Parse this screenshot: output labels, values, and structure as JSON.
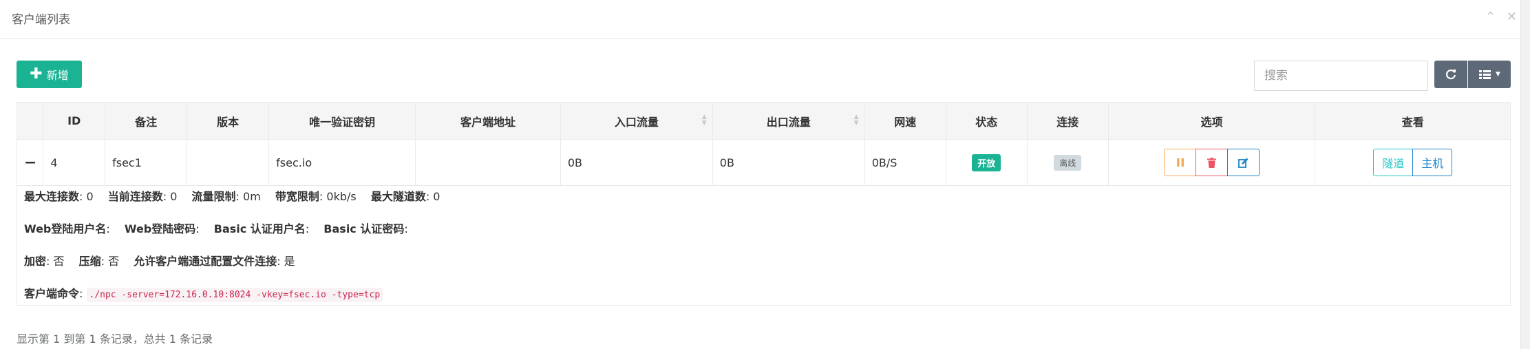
{
  "panel": {
    "title": "客户端列表",
    "collapse_icon": "chevron-up-icon",
    "close_icon": "close-icon"
  },
  "toolbar": {
    "add_label": "新增",
    "search_placeholder": "搜索",
    "refresh_icon": "refresh-icon",
    "columns_icon": "list-columns-icon"
  },
  "table": {
    "headers": [
      "",
      "ID",
      "备注",
      "版本",
      "唯一验证密钥",
      "客户端地址",
      "入口流量",
      "出口流量",
      "网速",
      "状态",
      "连接",
      "选项",
      "查看"
    ],
    "rows": [
      {
        "expand": "−",
        "id": "4",
        "remark": "fsec1",
        "version": "",
        "vkey": "fsec.io",
        "address": "",
        "in_flow": "0B",
        "out_flow": "0B",
        "speed": "0B/S",
        "status": "开放",
        "connection": "离线",
        "view_tunnel": "隧道",
        "view_host": "主机"
      }
    ],
    "detail": {
      "max_conn_label": "最大连接数",
      "max_conn": ": 0",
      "cur_conn_label": "当前连接数",
      "cur_conn": ": 0",
      "flow_limit_label": "流量限制",
      "flow_limit": ": 0m",
      "rate_limit_label": "带宽限制",
      "rate_limit": ": 0kb/s",
      "max_tunnel_label": "最大隧道数",
      "max_tunnel": ": 0",
      "web_user_label": "Web登陆用户名",
      "web_user": ":",
      "web_pass_label": "Web登陆密码",
      "web_pass": ":",
      "basic_user_label": "Basic 认证用户名",
      "basic_user": ":",
      "basic_pass_label": "Basic 认证密码",
      "basic_pass": ":",
      "encrypt_label": "加密",
      "encrypt": ": 否",
      "compress_label": "压缩",
      "compress": ": 否",
      "config_conn_label": "允许客户端通过配置文件连接",
      "config_conn": ": 是",
      "cmd_label": "客户端命令",
      "cmd_sep": ":",
      "cmd": "./npc -server=172.16.0.10:8024 -vkey=fsec.io -type=tcp"
    }
  },
  "footer": {
    "summary": "显示第 1 到第 1 条记录，总共 1 条记录"
  },
  "colors": {
    "primary": "#1ab394",
    "warning": "#f8ac59",
    "danger": "#ed5565",
    "info": "#1c84c6",
    "cyan": "#23c6c8",
    "dark_btn": "#5e6978"
  }
}
